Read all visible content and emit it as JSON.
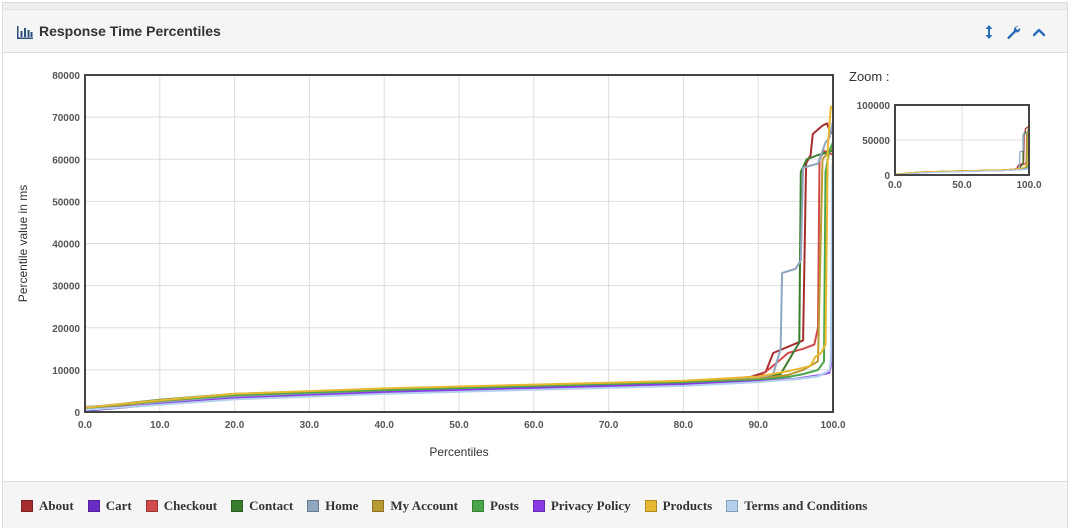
{
  "panel": {
    "title": "Response Time Percentiles",
    "zoom_label": "Zoom :"
  },
  "icons": {
    "title": "bar-chart-icon",
    "tools": [
      "resize-vertical-icon",
      "wrench-icon",
      "chevron-up-icon"
    ]
  },
  "colors": {
    "accent": "#2a6ebb",
    "grid": "#dddddd"
  },
  "chart_data": {
    "type": "line",
    "title": "",
    "xlabel": "Percentiles",
    "ylabel": "Percentile value in ms",
    "xlim": [
      0,
      100
    ],
    "ylim": [
      0,
      80000
    ],
    "x_ticks": [
      "0.0",
      "10.0",
      "20.0",
      "30.0",
      "40.0",
      "50.0",
      "60.0",
      "70.0",
      "80.0",
      "90.0",
      "100.0"
    ],
    "y_ticks": [
      "0",
      "10000",
      "20000",
      "30000",
      "40000",
      "50000",
      "60000",
      "70000",
      "80000"
    ],
    "grid": true,
    "legend_position": "bottom",
    "series": [
      {
        "name": "About",
        "color": "#a62d2d",
        "points": [
          [
            0,
            800
          ],
          [
            10,
            2700
          ],
          [
            20,
            4200
          ],
          [
            40,
            5500
          ],
          [
            60,
            6300
          ],
          [
            80,
            7200
          ],
          [
            89,
            8300
          ],
          [
            91,
            9500
          ],
          [
            92,
            14000
          ],
          [
            96,
            17000
          ],
          [
            96.4,
            59000
          ],
          [
            97,
            61000
          ],
          [
            97.3,
            66000
          ],
          [
            98.6,
            68000
          ],
          [
            99.2,
            68500
          ],
          [
            99.5,
            67000
          ],
          [
            100,
            66000
          ]
        ]
      },
      {
        "name": "Cart",
        "color": "#6a2cc7",
        "points": [
          [
            0,
            300
          ],
          [
            10,
            1800
          ],
          [
            20,
            3200
          ],
          [
            40,
            4600
          ],
          [
            60,
            5600
          ],
          [
            80,
            6500
          ],
          [
            90,
            7300
          ],
          [
            95,
            7800
          ],
          [
            98,
            8500
          ],
          [
            99.2,
            9500
          ],
          [
            99.6,
            10000
          ],
          [
            99.8,
            14000
          ],
          [
            100,
            15000
          ]
        ]
      },
      {
        "name": "Checkout",
        "color": "#d24a4a",
        "points": [
          [
            0,
            700
          ],
          [
            10,
            2500
          ],
          [
            20,
            4100
          ],
          [
            40,
            5300
          ],
          [
            60,
            6200
          ],
          [
            80,
            7000
          ],
          [
            90,
            8200
          ],
          [
            92,
            11000
          ],
          [
            94,
            14000
          ],
          [
            96,
            15000
          ],
          [
            97.5,
            16000
          ],
          [
            98,
            20000
          ],
          [
            98.2,
            60000
          ],
          [
            98.8,
            62000
          ],
          [
            99.5,
            61500
          ],
          [
            100,
            61000
          ]
        ]
      },
      {
        "name": "Contact",
        "color": "#3a7d2f",
        "points": [
          [
            0,
            1000
          ],
          [
            10,
            2900
          ],
          [
            20,
            4300
          ],
          [
            40,
            5400
          ],
          [
            60,
            6300
          ],
          [
            80,
            7100
          ],
          [
            90,
            8300
          ],
          [
            93,
            9000
          ],
          [
            95.5,
            16500
          ],
          [
            95.7,
            57000
          ],
          [
            96.5,
            60000
          ],
          [
            98,
            61000
          ],
          [
            99,
            61500
          ],
          [
            99.8,
            62000
          ],
          [
            100,
            62000
          ]
        ]
      },
      {
        "name": "Home",
        "color": "#8fa6c0",
        "points": [
          [
            0,
            1200
          ],
          [
            10,
            2300
          ],
          [
            20,
            3600
          ],
          [
            40,
            4900
          ],
          [
            60,
            5900
          ],
          [
            80,
            6800
          ],
          [
            90,
            8000
          ],
          [
            92,
            9000
          ],
          [
            93,
            15000
          ],
          [
            93.2,
            33000
          ],
          [
            95,
            34000
          ],
          [
            95.7,
            36000
          ],
          [
            96,
            58000
          ],
          [
            98,
            59000
          ],
          [
            99,
            64000
          ],
          [
            99.5,
            65000
          ],
          [
            100,
            69000
          ]
        ]
      },
      {
        "name": "My Account",
        "color": "#b89a33",
        "points": [
          [
            0,
            800
          ],
          [
            10,
            2600
          ],
          [
            20,
            4000
          ],
          [
            40,
            5300
          ],
          [
            60,
            6200
          ],
          [
            80,
            7000
          ],
          [
            90,
            7800
          ],
          [
            94,
            8800
          ],
          [
            96,
            10000
          ],
          [
            98,
            12000
          ],
          [
            98.6,
            60000
          ],
          [
            99.5,
            62000
          ],
          [
            100,
            63000
          ]
        ]
      },
      {
        "name": "Posts",
        "color": "#4aa64a",
        "points": [
          [
            0,
            900
          ],
          [
            10,
            2700
          ],
          [
            20,
            4000
          ],
          [
            40,
            5200
          ],
          [
            60,
            6100
          ],
          [
            80,
            6900
          ],
          [
            90,
            7600
          ],
          [
            94,
            8300
          ],
          [
            96,
            9000
          ],
          [
            98,
            10000
          ],
          [
            98.8,
            12000
          ],
          [
            99,
            57000
          ],
          [
            99.5,
            62000
          ],
          [
            100,
            64000
          ]
        ]
      },
      {
        "name": "Privacy Policy",
        "color": "#8a3be6",
        "points": [
          [
            0,
            400
          ],
          [
            10,
            1900
          ],
          [
            20,
            3300
          ],
          [
            40,
            4700
          ],
          [
            60,
            5700
          ],
          [
            80,
            6600
          ],
          [
            90,
            7300
          ],
          [
            95,
            7900
          ],
          [
            98,
            8700
          ],
          [
            99.5,
            9300
          ],
          [
            99.7,
            11000
          ],
          [
            99.9,
            16500
          ],
          [
            100,
            16500
          ]
        ]
      },
      {
        "name": "Products",
        "color": "#e8b830",
        "points": [
          [
            0,
            1000
          ],
          [
            10,
            2800
          ],
          [
            20,
            4300
          ],
          [
            40,
            5600
          ],
          [
            60,
            6500
          ],
          [
            80,
            7400
          ],
          [
            90,
            8400
          ],
          [
            94,
            9700
          ],
          [
            96,
            10500
          ],
          [
            97,
            11000
          ],
          [
            97.6,
            13000
          ],
          [
            98.4,
            14000
          ],
          [
            99,
            16000
          ],
          [
            99.3,
            63000
          ],
          [
            99.7,
            72500
          ],
          [
            100,
            72500
          ]
        ]
      },
      {
        "name": "Terms and Conditions",
        "color": "#b3d1ef",
        "points": [
          [
            0,
            500
          ],
          [
            10,
            1700
          ],
          [
            20,
            3000
          ],
          [
            40,
            4300
          ],
          [
            60,
            5300
          ],
          [
            80,
            6200
          ],
          [
            90,
            7100
          ],
          [
            95,
            7800
          ],
          [
            98,
            8500
          ],
          [
            99.5,
            9800
          ],
          [
            99.7,
            12000
          ],
          [
            99.9,
            58000
          ],
          [
            100,
            60000
          ]
        ]
      }
    ]
  },
  "zoom_chart": {
    "xlim": [
      0,
      100
    ],
    "ylim": [
      0,
      100000
    ],
    "x_ticks": [
      "0.0",
      "50.0",
      "100.0"
    ],
    "y_ticks": [
      "0",
      "50000",
      "100000"
    ]
  }
}
